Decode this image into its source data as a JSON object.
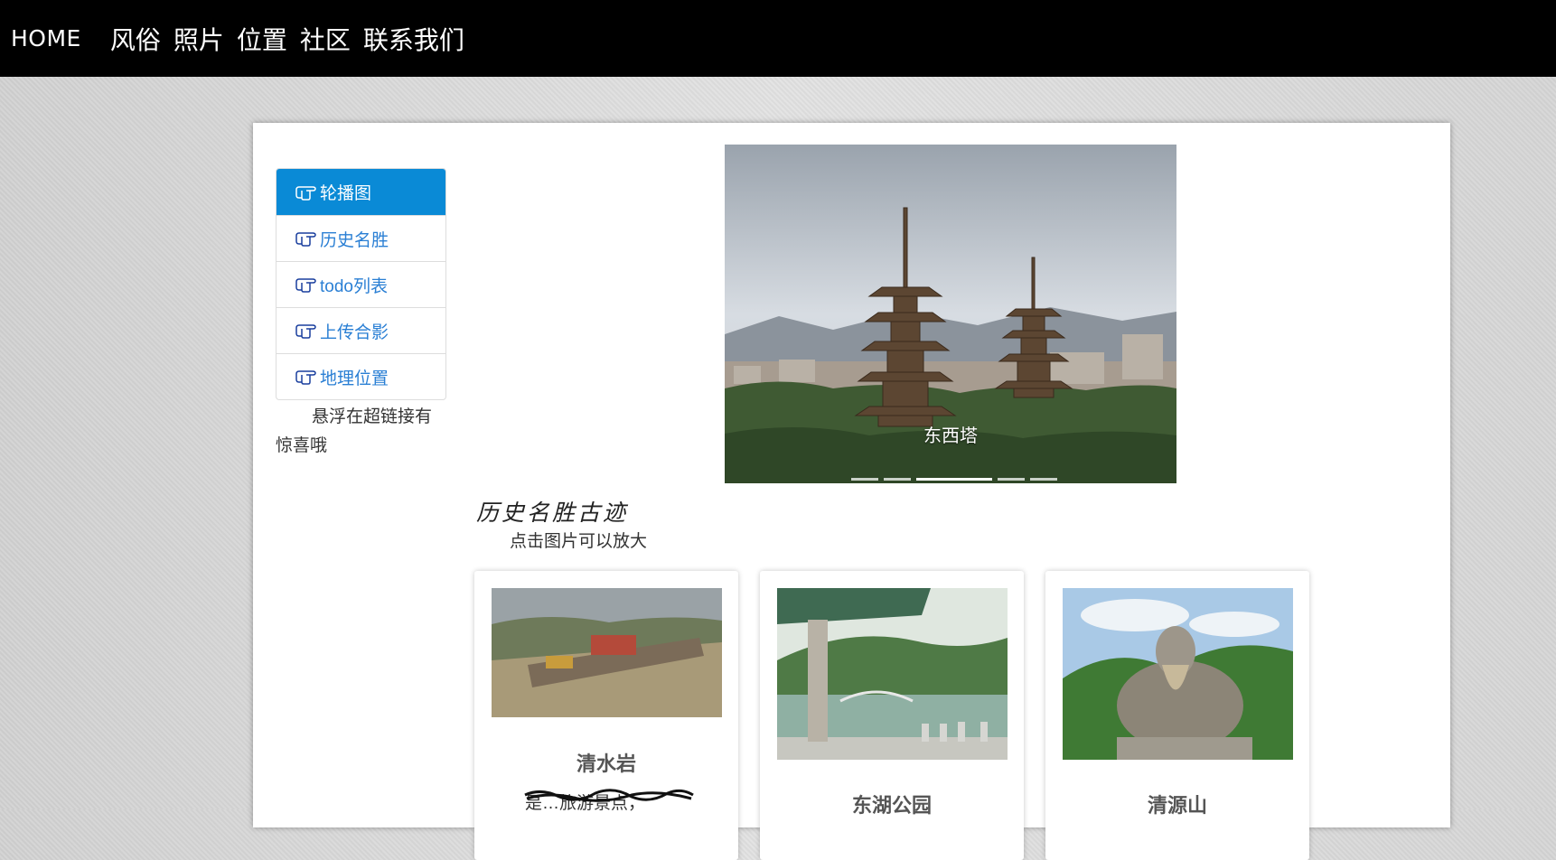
{
  "nav": {
    "home": "HOME",
    "links": [
      "风俗",
      "照片",
      "位置",
      "社区",
      "联系我们"
    ]
  },
  "sidebar": {
    "items": [
      {
        "label": "轮播图",
        "active": true
      },
      {
        "label": "历史名胜",
        "active": false
      },
      {
        "label": "todo列表",
        "active": false
      },
      {
        "label": "上传合影",
        "active": false
      },
      {
        "label": "地理位置",
        "active": false
      }
    ],
    "note": "悬浮在超链接有惊喜哦"
  },
  "carousel": {
    "caption": "东西塔",
    "indicator_count": 5,
    "active_index": 2
  },
  "section": {
    "title": "历史名胜古迹",
    "hint": "点击图片可以放大"
  },
  "cards": [
    {
      "title": "清水岩",
      "desc": "是…旅游景点，"
    },
    {
      "title": "东湖公园"
    },
    {
      "title": "清源山"
    }
  ],
  "colors": {
    "nav_bg": "#000000",
    "active_item": "#0a8ad6",
    "link": "#2a7fd4"
  }
}
